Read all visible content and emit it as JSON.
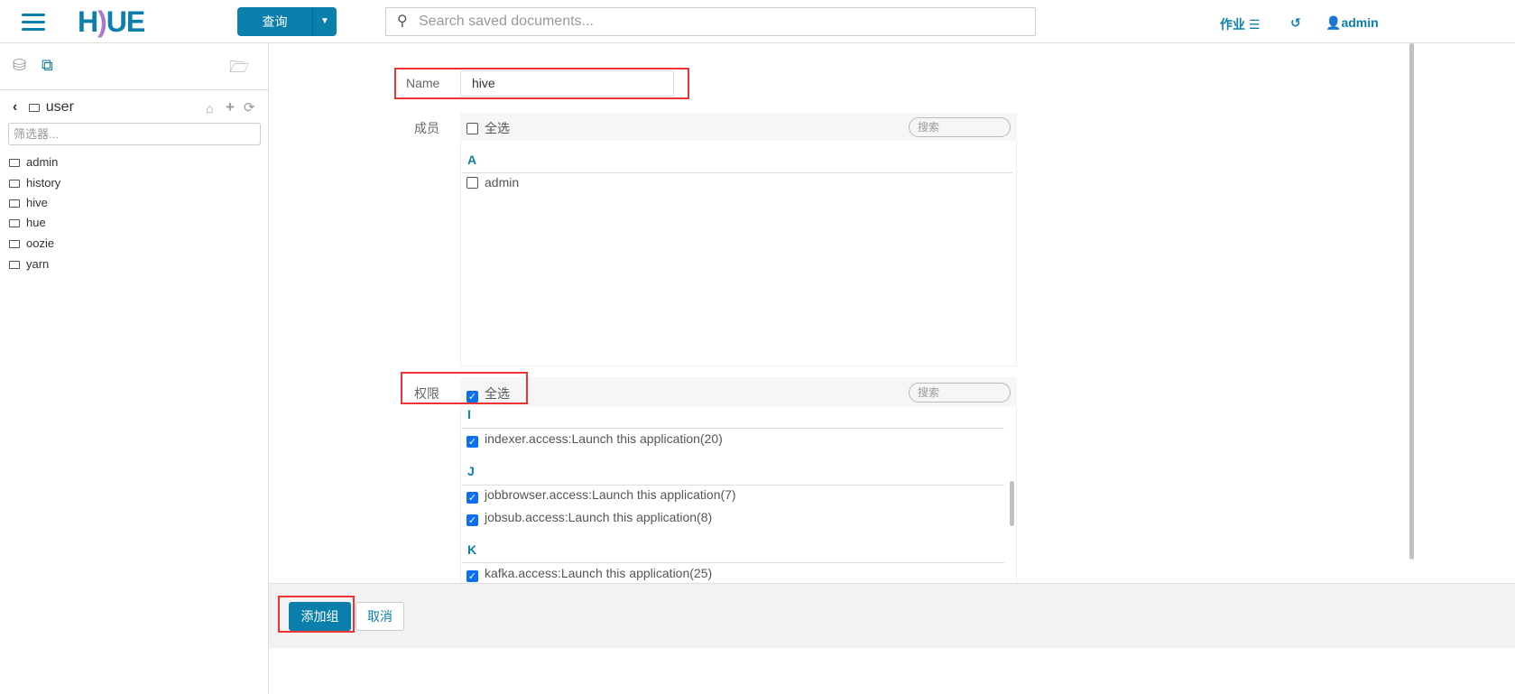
{
  "topbar": {
    "logo": "HUE",
    "query_button": "查询",
    "search_placeholder": "Search saved documents...",
    "jobs": "作业",
    "user": "admin"
  },
  "sidebar": {
    "path": "user",
    "filter_placeholder": "筛选器...",
    "folders": [
      "admin",
      "history",
      "hive",
      "hue",
      "oozie",
      "yarn"
    ]
  },
  "form": {
    "name_label": "Name",
    "name_value": "hive",
    "members": {
      "label": "成员",
      "select_all": "全选",
      "search_placeholder": "搜索",
      "groups": [
        {
          "letter": "A",
          "items": [
            {
              "label": "admin",
              "checked": false
            }
          ]
        }
      ]
    },
    "permissions": {
      "label": "权限",
      "select_all": "全选",
      "select_all_checked": true,
      "search_placeholder": "搜索",
      "groups": [
        {
          "letter": "I",
          "items": [
            {
              "label": "indexer.access:Launch this application(20)",
              "checked": true
            }
          ]
        },
        {
          "letter": "J",
          "items": [
            {
              "label": "jobbrowser.access:Launch this application(7)",
              "checked": true
            },
            {
              "label": "jobsub.access:Launch this application(8)",
              "checked": true
            }
          ]
        },
        {
          "letter": "K",
          "items": [
            {
              "label": "kafka.access:Launch this application(25)",
              "checked": true
            }
          ]
        }
      ]
    }
  },
  "footer": {
    "add_group": "添加组",
    "cancel": "取消"
  },
  "colors": {
    "brand": "#0b7fab",
    "highlight": "#e33333",
    "checkbox": "#0b6ff0"
  }
}
